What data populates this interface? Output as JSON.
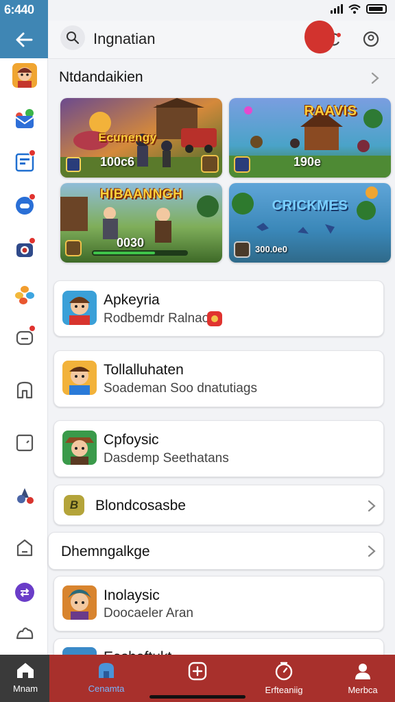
{
  "status": {
    "time": "6:440"
  },
  "header": {
    "title": "Ingnatian"
  },
  "section": {
    "title": "Ntdandaikien"
  },
  "games": [
    {
      "title": "Ecunengy",
      "count": "100c6"
    },
    {
      "title": "RAAVIS",
      "count": "190e"
    },
    {
      "title": "HIBAANNGH",
      "count": "0030"
    },
    {
      "title": "CRICKMES",
      "count": "300.0e0"
    }
  ],
  "list": [
    {
      "title": "Apkeyria",
      "subtitle": "Rodbemdr Ralnao"
    },
    {
      "title": "Tollalluhaten",
      "subtitle": "Soademan Soo dnatutiags"
    },
    {
      "title": "Cpfoysic",
      "subtitle": "Dasdemp Seethatans"
    },
    {
      "title": "Blondcosasbe",
      "badge": "B"
    },
    {
      "title": "Dhemngalkge"
    },
    {
      "title": "Inolaysic",
      "subtitle": "Doocaeler Aran"
    },
    {
      "title": "Eashaftukt"
    }
  ],
  "nav": [
    {
      "label": "Mnam",
      "icon": "home-icon"
    },
    {
      "label": "Cenamta",
      "icon": "store-icon"
    },
    {
      "label": "",
      "icon": "add-icon"
    },
    {
      "label": "Erfteaniig",
      "icon": "timer-icon"
    },
    {
      "label": "Merbca",
      "icon": "profile-icon"
    }
  ],
  "colors": {
    "accent": "#3f86b4",
    "nav_bar": "#a8302c",
    "notification": "#e0332f"
  }
}
